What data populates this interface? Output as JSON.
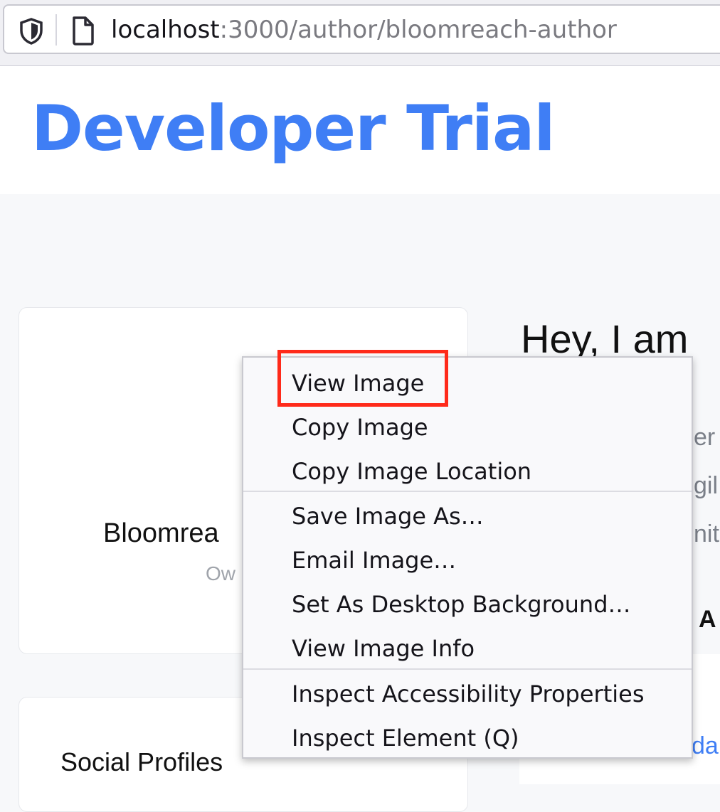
{
  "address_bar": {
    "url_host": "localhost",
    "url_path": ":3000/author/bloomreach-author",
    "icons": [
      "shield-icon",
      "page-icon"
    ]
  },
  "site": {
    "brand": "Developer Trial",
    "brand_color": "#3f7ef5"
  },
  "profile_card": {
    "name": "Bloomrea",
    "role": "Ow"
  },
  "social_card": {
    "title": "Social Profiles"
  },
  "right_column": {
    "greeting": "Hey, I am",
    "fragments": [
      "er",
      "gil",
      "nit"
    ],
    "heading_fragment": "A",
    "link_fragment": "da"
  },
  "context_menu": {
    "items": [
      {
        "label": "View Image"
      },
      {
        "label": "Copy Image"
      },
      {
        "label": "Copy Image Location"
      },
      {
        "label": "Save Image As…"
      },
      {
        "label": "Email Image…"
      },
      {
        "label": "Set As Desktop Background…"
      },
      {
        "label": "View Image Info"
      },
      {
        "label": "Inspect Accessibility Properties"
      },
      {
        "label": "Inspect Element (Q)"
      }
    ],
    "highlight_color": "#ff2a1a"
  }
}
